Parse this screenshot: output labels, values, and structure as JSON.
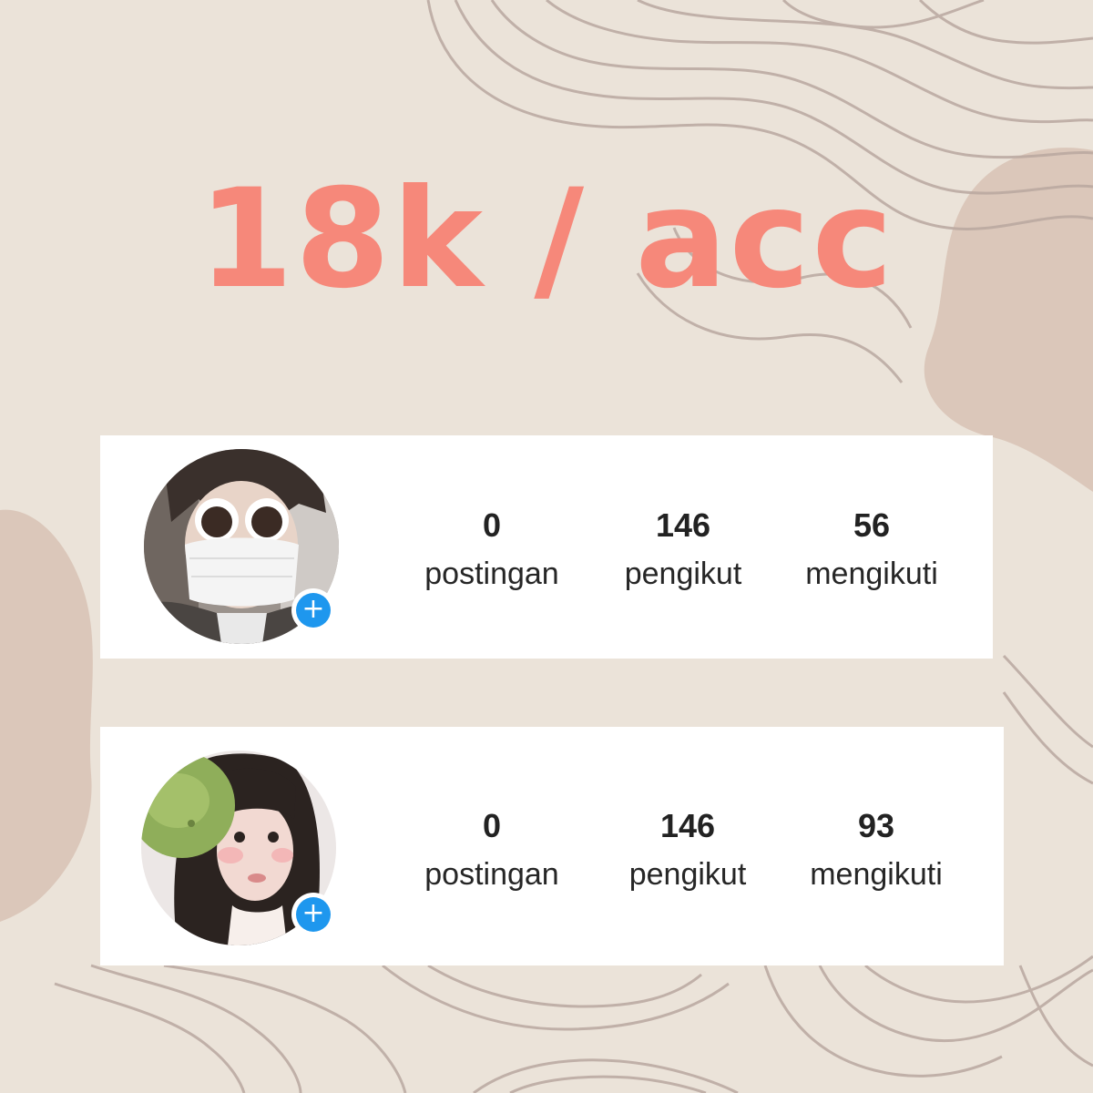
{
  "headline": "18k / acc",
  "accounts": [
    {
      "avatar_icon": "profile-photo",
      "add_icon": "plus-icon",
      "stats": [
        {
          "value": "0",
          "label": "postingan"
        },
        {
          "value": "146",
          "label": "pengikut"
        },
        {
          "value": "56",
          "label": "mengikuti"
        }
      ]
    },
    {
      "avatar_icon": "profile-photo",
      "add_icon": "plus-icon",
      "stats": [
        {
          "value": "0",
          "label": "postingan"
        },
        {
          "value": "146",
          "label": "pengikut"
        },
        {
          "value": "93",
          "label": "mengikuti"
        }
      ]
    }
  ],
  "colors": {
    "background": "#ebe3d9",
    "headline": "#f6887a",
    "blob": "#dbc7ba",
    "line": "#b9a8a0",
    "badge": "#1e97ee"
  }
}
